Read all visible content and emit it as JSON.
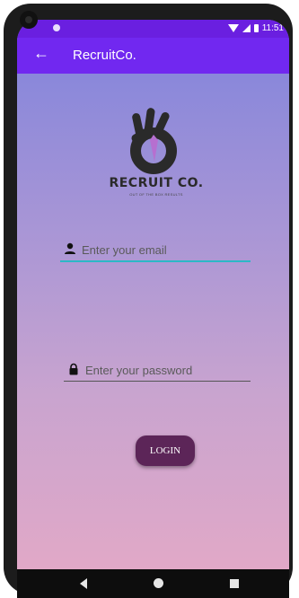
{
  "status_bar": {
    "time": "11:51"
  },
  "app_bar": {
    "title": "RecruitCo.",
    "back_icon": "arrow-left-icon"
  },
  "logo": {
    "name": "RECRUIT CO.",
    "tagline": "OUT OF THE BOX RESULTS"
  },
  "form": {
    "email": {
      "placeholder": "Enter your email",
      "value": "",
      "icon": "person-icon"
    },
    "password": {
      "placeholder": "Enter your password",
      "value": "",
      "icon": "lock-icon"
    },
    "login_label": "LOGIN"
  },
  "colors": {
    "status_bar": "#6a1fe0",
    "app_bar": "#7128f0",
    "gradient_top": "#7f83dc",
    "gradient_bottom": "#e5a9c6",
    "accent": "#2bb8c6",
    "button": "#5c2558",
    "logo_accent": "#b66fd0"
  },
  "nav_bar": {
    "icons": [
      "nav-back-icon",
      "nav-home-icon",
      "nav-recent-icon"
    ]
  }
}
